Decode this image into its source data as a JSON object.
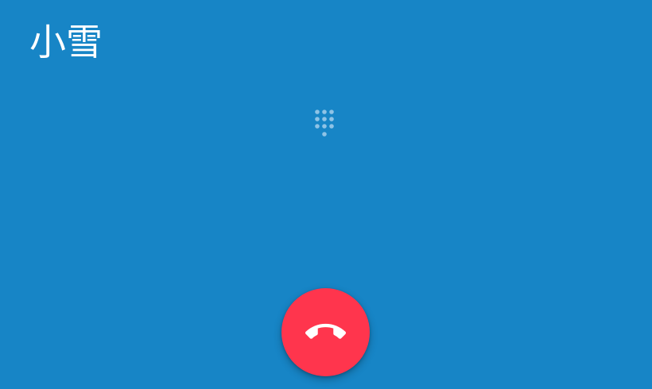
{
  "caller": {
    "name": "小雪"
  },
  "controls": {
    "dialpad_icon": "dialpad-icon",
    "end_call_icon": "call-end-icon"
  },
  "colors": {
    "background": "#1785C6",
    "end_call": "#FF354D",
    "text": "#FFFFFF",
    "dialpad_dots": "#8EC3E6"
  }
}
